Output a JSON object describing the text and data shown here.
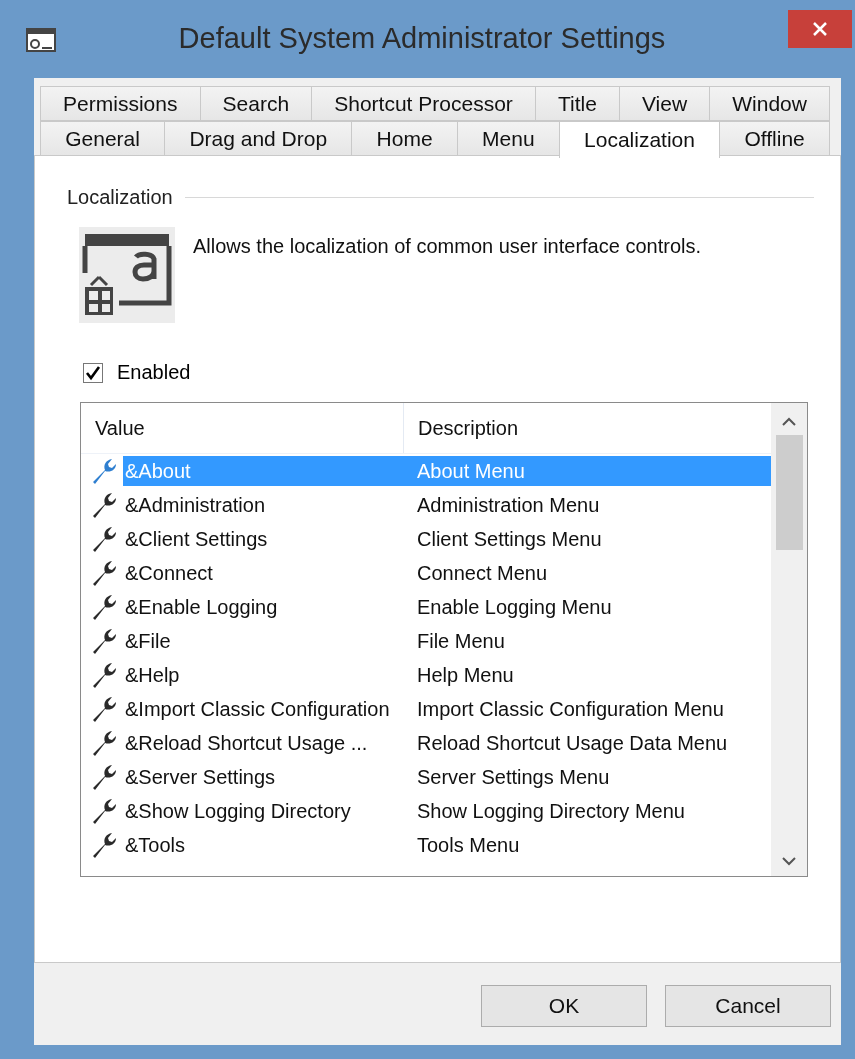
{
  "window": {
    "title": "Default System Administrator Settings"
  },
  "tab_rows": [
    [
      {
        "label": "Permissions",
        "selected": false
      },
      {
        "label": "Search",
        "selected": false
      },
      {
        "label": "Shortcut Processor",
        "selected": false
      },
      {
        "label": "Title",
        "selected": false
      },
      {
        "label": "View",
        "selected": false
      },
      {
        "label": "Window",
        "selected": false
      }
    ],
    [
      {
        "label": "General",
        "selected": false
      },
      {
        "label": "Drag and Drop",
        "selected": false
      },
      {
        "label": "Home",
        "selected": false
      },
      {
        "label": "Menu",
        "selected": false
      },
      {
        "label": "Localization",
        "selected": true
      },
      {
        "label": "Offline",
        "selected": false
      }
    ]
  ],
  "section": {
    "title": "Localization",
    "description": "Allows the localization of common user interface controls."
  },
  "enabled": {
    "label": "Enabled",
    "checked": true
  },
  "table": {
    "columns": [
      "Value",
      "Description"
    ],
    "rows": [
      {
        "value": "&About",
        "description": "About Menu",
        "selected": true
      },
      {
        "value": "&Administration",
        "description": "Administration Menu",
        "selected": false
      },
      {
        "value": "&Client Settings",
        "description": "Client Settings Menu",
        "selected": false
      },
      {
        "value": "&Connect",
        "description": "Connect Menu",
        "selected": false
      },
      {
        "value": "&Enable Logging",
        "description": "Enable Logging Menu",
        "selected": false
      },
      {
        "value": "&File",
        "description": "File Menu",
        "selected": false
      },
      {
        "value": "&Help",
        "description": "Help Menu",
        "selected": false
      },
      {
        "value": "&Import Classic Configuration",
        "description": "Import Classic Configuration Menu",
        "selected": false
      },
      {
        "value": "&Reload Shortcut Usage ...",
        "description": "Reload Shortcut Usage Data Menu",
        "selected": false
      },
      {
        "value": "&Server Settings",
        "description": "Server Settings Menu",
        "selected": false
      },
      {
        "value": "&Show Logging Directory",
        "description": "Show Logging Directory Menu",
        "selected": false
      },
      {
        "value": "&Tools",
        "description": "Tools Menu",
        "selected": false
      }
    ]
  },
  "buttons": [
    "OK",
    "Cancel"
  ]
}
